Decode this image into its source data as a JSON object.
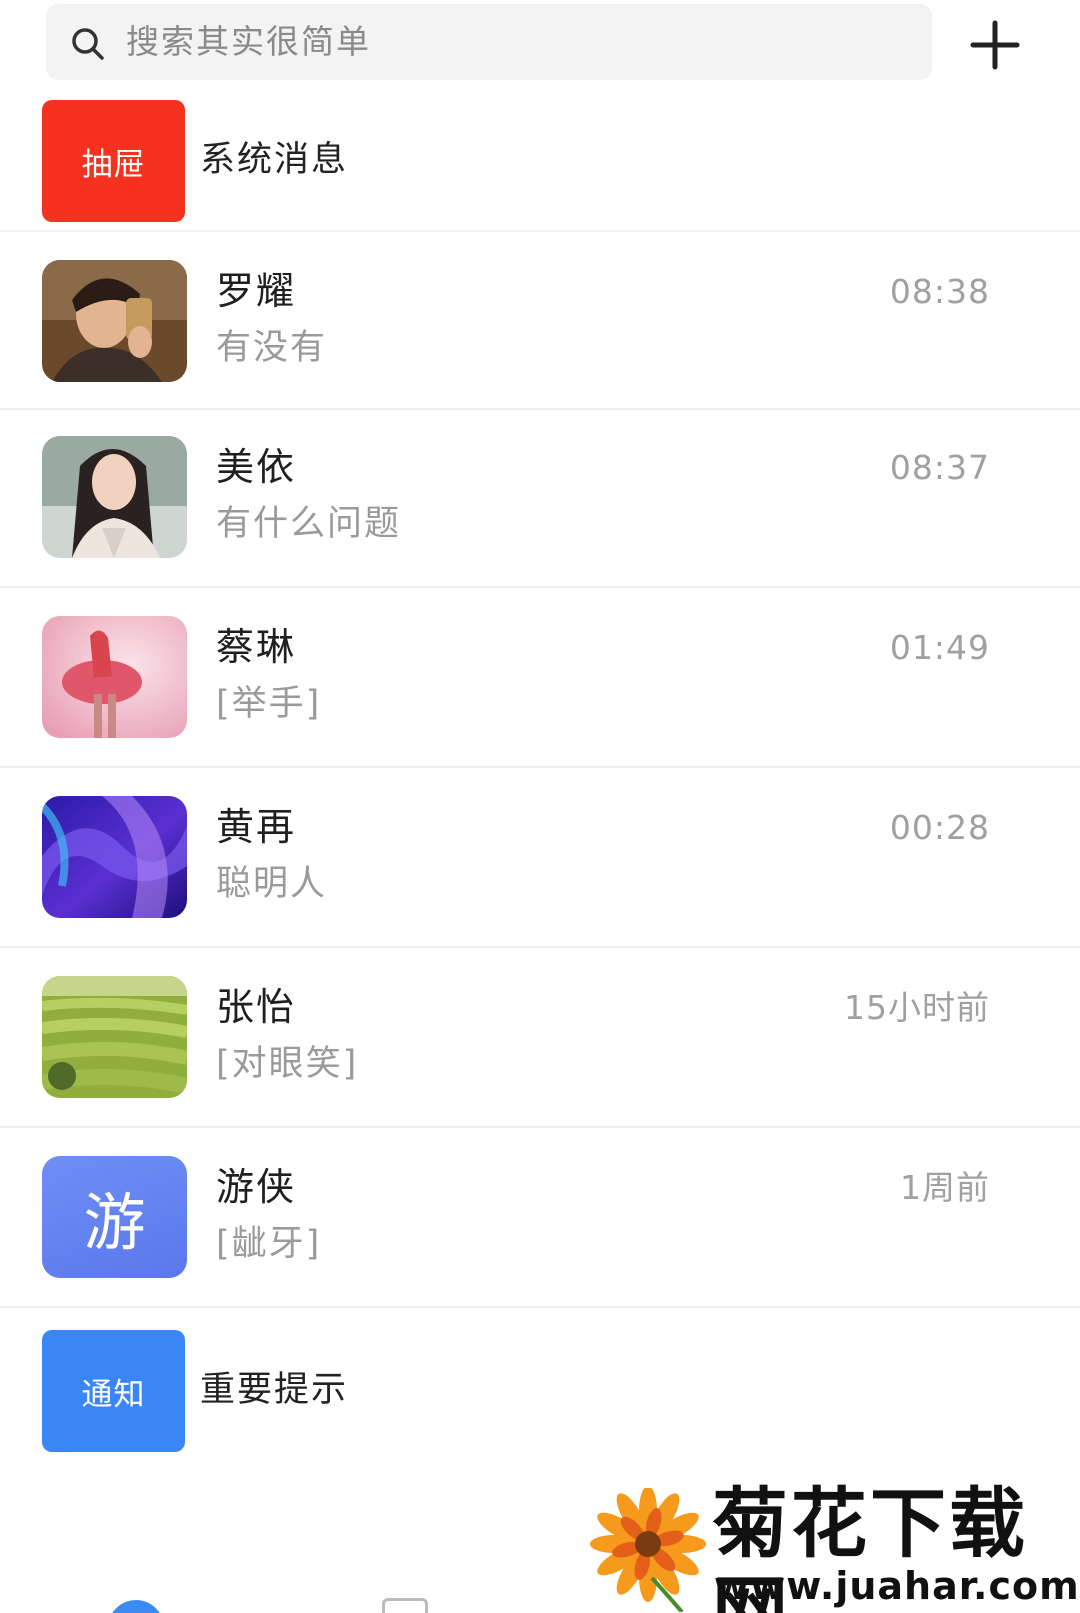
{
  "search": {
    "placeholder": "搜索其实很简单"
  },
  "system_rows": [
    {
      "badge": "抽屉",
      "text": "系统消息",
      "color": "#f5321f"
    },
    {
      "badge": "通知",
      "text": "重要提示",
      "color": "#3b86f6"
    }
  ],
  "chats": [
    {
      "name": "罗耀",
      "message": "有没有",
      "time": "08:38",
      "avatar": "photo-young-man-selfie"
    },
    {
      "name": "美依",
      "message": "有什么问题",
      "time": "08:37",
      "avatar": "photo-woman-portrait"
    },
    {
      "name": "蔡琳",
      "message": "[举手]",
      "time": "01:49",
      "avatar": "photo-dancer-pink"
    },
    {
      "name": "黄再",
      "message": "聪明人",
      "time": "00:28",
      "avatar": "abstract-purple-blue"
    },
    {
      "name": "张怡",
      "message": "[对眼笑]",
      "time": "15小时前",
      "avatar": "photo-tea-field"
    },
    {
      "name": "游侠",
      "message": "[龇牙]",
      "time": "1周前",
      "avatar_letter": "游"
    }
  ],
  "watermark": {
    "title": "菊花下载网",
    "url": "www.juahar.com"
  }
}
